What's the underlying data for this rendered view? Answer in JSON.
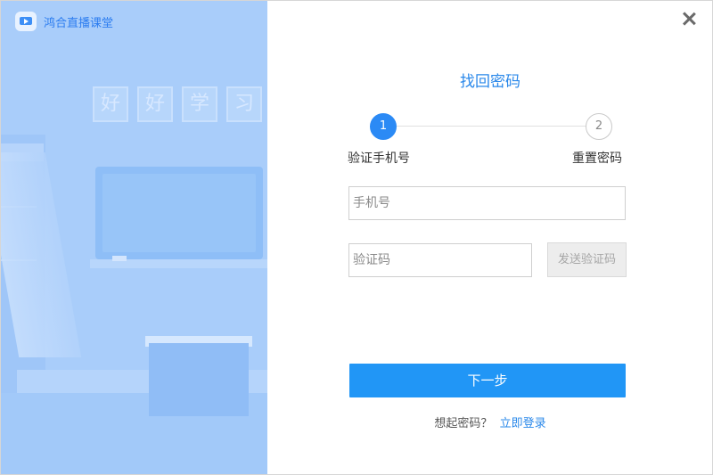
{
  "app": {
    "name": "鸿合直播课堂",
    "logo_icon": "video-play-icon"
  },
  "illustration": {
    "motto": [
      "好",
      "好",
      "学",
      "习"
    ]
  },
  "window": {
    "close_icon": "close-icon"
  },
  "form": {
    "title": "找回密码",
    "steps": [
      {
        "number": "1",
        "label": "验证手机号",
        "active": true
      },
      {
        "number": "2",
        "label": "重置密码",
        "active": false
      }
    ],
    "phone": {
      "placeholder": "手机号",
      "value": ""
    },
    "code": {
      "placeholder": "验证码",
      "value": ""
    },
    "send_code_label": "发送验证码",
    "next_label": "下一步",
    "remember_text": "想起密码？",
    "login_link": "立即登录"
  },
  "colors": {
    "accent": "#2196f6",
    "title": "#2a88ea",
    "panel": "#a9cdfa"
  }
}
